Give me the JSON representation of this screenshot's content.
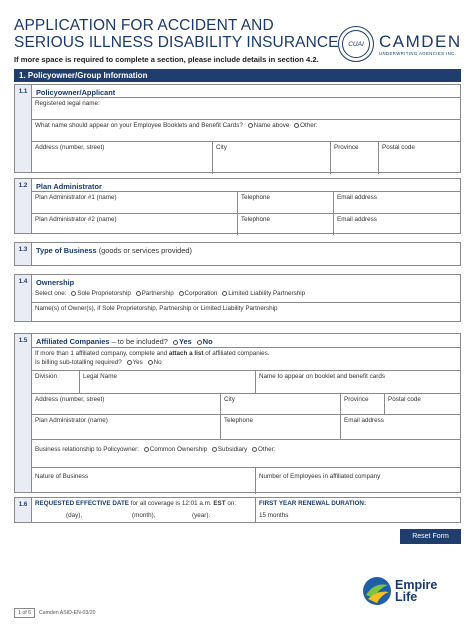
{
  "header": {
    "title_line1": "APPLICATION FOR ACCIDENT AND",
    "title_line2": "SERIOUS ILLNESS DISABILITY INSURANCE",
    "subtitle": "If more space is required to complete a section, please include details in section 4.2."
  },
  "camden_logo": {
    "seal": "CUAI",
    "name": "CAMDEN",
    "tagline": "UNDERWRITING AGENCIES INC."
  },
  "section1": {
    "title": "1. Policyowner/Group Information"
  },
  "s1_1": {
    "num": "1.1",
    "head": "Policyowner/Applicant",
    "legal_name": "Registered legal name:",
    "booklet_q": "What name should appear on your Employee Booklets and Benefit Cards?",
    "opt_name_above": "Name above",
    "opt_other": "Other:",
    "address": "Address (number, street)",
    "city": "City",
    "province": "Province",
    "postal": "Postal code"
  },
  "s1_2": {
    "num": "1.2",
    "head": "Plan Administrator",
    "admin1": "Plan Administrator #1 (name)",
    "admin2": "Plan Administrator #2 (name)",
    "telephone": "Telephone",
    "email": "Email address"
  },
  "s1_3": {
    "num": "1.3",
    "head": "Type of Business",
    "head_note": "(goods or services provided)"
  },
  "s1_4": {
    "num": "1.4",
    "head": "Ownership",
    "select_one": "Select one:",
    "opt_sole": "Sole Proprietorship",
    "opt_partnership": "Partnership",
    "opt_corporation": "Corporation",
    "opt_llp": "Limited Liability Partnership",
    "owners": "Name(s) of Owner(s), if Sole Proprietorship, Partnership or Limited Liability Partnership"
  },
  "s1_5": {
    "num": "1.5",
    "head": "Affiliated Companies",
    "head_note": "– to be included?",
    "yes": "Yes",
    "no": "No",
    "note_pre": "If more than 1 affiliated company, complete and",
    "note_bold": "attach a list",
    "note_post": "of affiliated companies.",
    "billing_q": "Is billing sub-totalling required?",
    "division": "Division",
    "legal_name": "Legal Name",
    "booklet_name": "Name to appear on booklet and benefit cards",
    "address": "Address (number, street)",
    "city": "City",
    "province": "Province",
    "postal": "Postal code",
    "admin": "Plan Administrator (name)",
    "telephone": "Telephone",
    "email": "Email address",
    "relationship": "Business relationship to Policyowner:",
    "opt_common": "Common Ownership",
    "opt_subsidiary": "Subsidiary",
    "opt_other": "Other:",
    "nature": "Nature of Business",
    "num_employees": "Number of Employees in affiliated company"
  },
  "s1_6": {
    "num": "1.6",
    "effective_bold": "REQUESTED EFFECTIVE DATE",
    "effective_norm": "for all coverage is 12:01 a.m.",
    "est": "EST",
    "on": "on:",
    "day": "(day),",
    "month": "(month),",
    "year": "(year).",
    "renewal_head": "FIRST YEAR RENEWAL DURATION:",
    "renewal_value": "15 months"
  },
  "buttons": {
    "reset": "Reset Form"
  },
  "empire_logo": {
    "line1": "Empire",
    "line2": "Life"
  },
  "footer": {
    "page": "1 of 6",
    "code": "Camden ASID-EN-03/20"
  }
}
